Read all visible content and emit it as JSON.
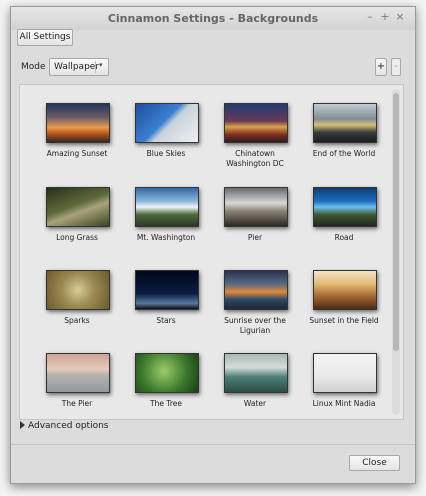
{
  "window": {
    "title": "Cinnamon Settings - Backgrounds",
    "minimize_icon": "minimize-icon",
    "maximize_icon": "maximize-icon",
    "close_icon": "close-icon"
  },
  "toolbar": {
    "all_settings": "All Settings"
  },
  "mode": {
    "label": "Mode",
    "value": "Wallpaper",
    "add": "+",
    "remove": "-"
  },
  "wallpapers": [
    {
      "name": "Amazing Sunset",
      "g": "linear-gradient(#253a58 0%,#6b5a66 35%,#e99b4a 62%,#b9541d 78%,#2f2a1e 100%)"
    },
    {
      "name": "Blue Skies",
      "g": "linear-gradient(135deg,#1e4f9a 0%,#3a7ed1 45%,#c9d3dc 55%,#eef0f2 100%)"
    },
    {
      "name": "Chinatown\nWashington DC",
      "g": "linear-gradient(#223a74 0%,#6a3a55 45%,#d6a44a 60%,#862e23 80%,#2a1c1c 100%)"
    },
    {
      "name": "End of the World",
      "g": "linear-gradient(#c0ccd2 0%,#7f8e94 40%,#d9c07a 55%,#35393a 75%,#1c1e1f 100%)"
    },
    {
      "name": "Long Grass",
      "g": "linear-gradient(160deg,#26301a 0%,#5e6a3a 45%,#a9a27a 60%,#3a4422 100%)"
    },
    {
      "name": "Mt. Washington",
      "g": "linear-gradient(#2f6aa8 0%,#8fb9dc 35%,#f2f4f6 50%,#4a6a3a 70%,#2a3a22 100%)"
    },
    {
      "name": "Pier",
      "g": "linear-gradient(#6a6a6a 0%,#d8d8d8 40%,#8c8478 60%,#2b2723 100%)"
    },
    {
      "name": "Road",
      "g": "linear-gradient(#0c3e74 0%,#1d6fc0 35%,#69c3ef 50%,#3e5a32 70%,#1e2a1c 100%)"
    },
    {
      "name": "Sparks",
      "g": "radial-gradient(circle at 50% 50%,#d8cd9a 0%,#9a8a52 45%,#6b5a2e 100%)"
    },
    {
      "name": "Stars",
      "g": "linear-gradient(#02061a 0%,#0b1d44 60%,#5a7a9a 85%,#0b0f18 100%)"
    },
    {
      "name": "Sunrise over the\nLigurian",
      "g": "linear-gradient(#2a3550 0%,#5c6a84 35%,#e18a3c 55%,#2c4a66 75%,#1a2534 100%)"
    },
    {
      "name": "Sunset in the Field",
      "g": "linear-gradient(#f1e3c8 0%,#e3b873 35%,#a86a33 65%,#4a2b17 100%)"
    },
    {
      "name": "The Pier",
      "g": "linear-gradient(#cba592 0%,#e6cabd 40%,#b7b1ae 55%,#8f9aa0 100%)"
    },
    {
      "name": "The Tree",
      "g": "radial-gradient(circle at 45% 45%,#9dcc6a 0%,#3c7a2c 55%,#1c3c14 100%)"
    },
    {
      "name": "Water",
      "g": "linear-gradient(#a9b9b6 0%,#d5dcd8 35%,#4e8278 60%,#2a4c46 100%)"
    },
    {
      "name": "Linux Mint Nadia",
      "g": "linear-gradient(#f5f5f5 0%,#e9e9e9 60%,#cfcfcf 100%)"
    }
  ],
  "advanced": "Advanced options",
  "footer": {
    "close": "Close"
  }
}
